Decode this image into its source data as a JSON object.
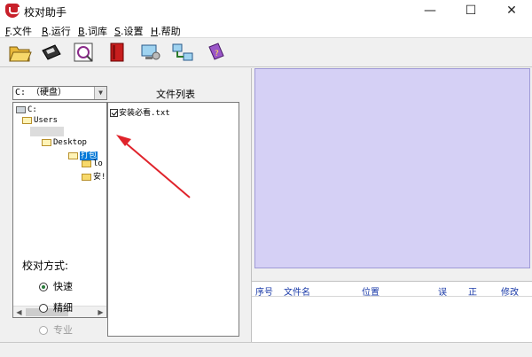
{
  "window": {
    "title": "校对助手",
    "controls": {
      "minimize": "—",
      "maximize": "☐",
      "close": "✕"
    }
  },
  "menu": [
    {
      "key": "F",
      "label": ".文件"
    },
    {
      "key": "R",
      "label": ".运行"
    },
    {
      "key": "B",
      "label": ".词库"
    },
    {
      "key": "S",
      "label": ".设置"
    },
    {
      "key": "H",
      "label": ".帮助"
    }
  ],
  "toolbar": {
    "buttons": [
      "open-folder-icon",
      "save-disk-icon",
      "proofread-icon",
      "dictionary-icon",
      "settings-computer-icon",
      "network-icon",
      "help-book-icon"
    ]
  },
  "left_panel": {
    "drive_select": {
      "value": "C: （硬盘）"
    },
    "file_list_label": "文件列表",
    "tree": {
      "nodes": [
        {
          "label": "C:"
        },
        {
          "label": "Users"
        },
        {
          "label": "Desktop"
        },
        {
          "label": "打包"
        },
        {
          "label": "lo"
        },
        {
          "label": "安!"
        }
      ]
    },
    "files": [
      {
        "name": "安装必看.txt",
        "checked": true
      }
    ],
    "mode": {
      "title": "校对方式:",
      "options": [
        {
          "label": "快速",
          "selected": true,
          "disabled": false
        },
        {
          "label": "精细",
          "selected": false,
          "disabled": false
        },
        {
          "label": "专业",
          "selected": false,
          "disabled": true
        }
      ]
    }
  },
  "results": {
    "columns": [
      "序号",
      "文件名",
      "位置",
      "误",
      "正",
      "修改"
    ]
  },
  "colors": {
    "preview_bg": "#d5d0f5",
    "annotation_arrow": "#e0232b",
    "selection": "#0078d7"
  }
}
